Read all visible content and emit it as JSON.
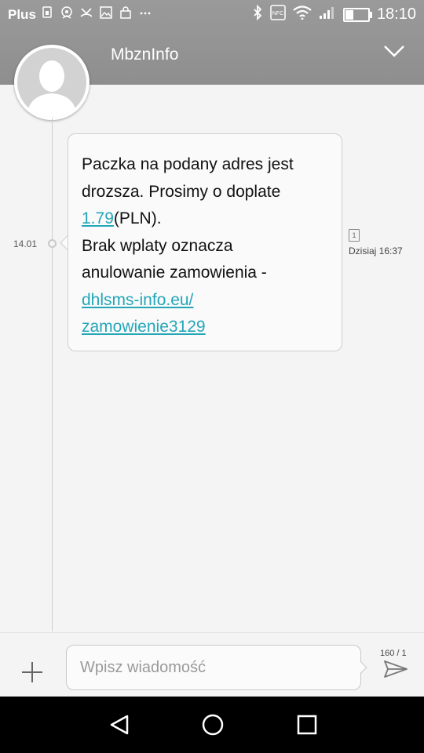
{
  "status_bar": {
    "carrier": "Plus",
    "time": "18:10",
    "icons": [
      "sim-icon",
      "notification-icon",
      "missed-call-icon",
      "image-icon",
      "bag-icon",
      "more-icon",
      "bluetooth-icon",
      "nfc-icon",
      "wifi-icon",
      "signal-icon",
      "battery-icon"
    ],
    "nfc_label": "NFC"
  },
  "header": {
    "contact_name": "MbznInfo"
  },
  "timeline": {
    "date_label": "14.01"
  },
  "message": {
    "lines": [
      {
        "text": "Paczka na podany adres jest"
      },
      {
        "text": "drozsza. Prosimy o doplate"
      },
      {
        "link": "1.79",
        "text": "(PLN)."
      },
      {
        "text": "Brak wplaty oznacza"
      },
      {
        "text": "anulowanie zamowienia -"
      },
      {
        "link": "dhlsms-info.eu/"
      },
      {
        "link": "zamowienie3129"
      }
    ],
    "sim_slot": "1",
    "timestamp": "Dzisiaj 16:37"
  },
  "composer": {
    "placeholder": "Wpisz wiadomość",
    "counter": "160 / 1"
  },
  "colors": {
    "header_bg": "#939393",
    "link": "#22a6b8",
    "background": "#f4f4f4",
    "navbar": "#000000"
  }
}
